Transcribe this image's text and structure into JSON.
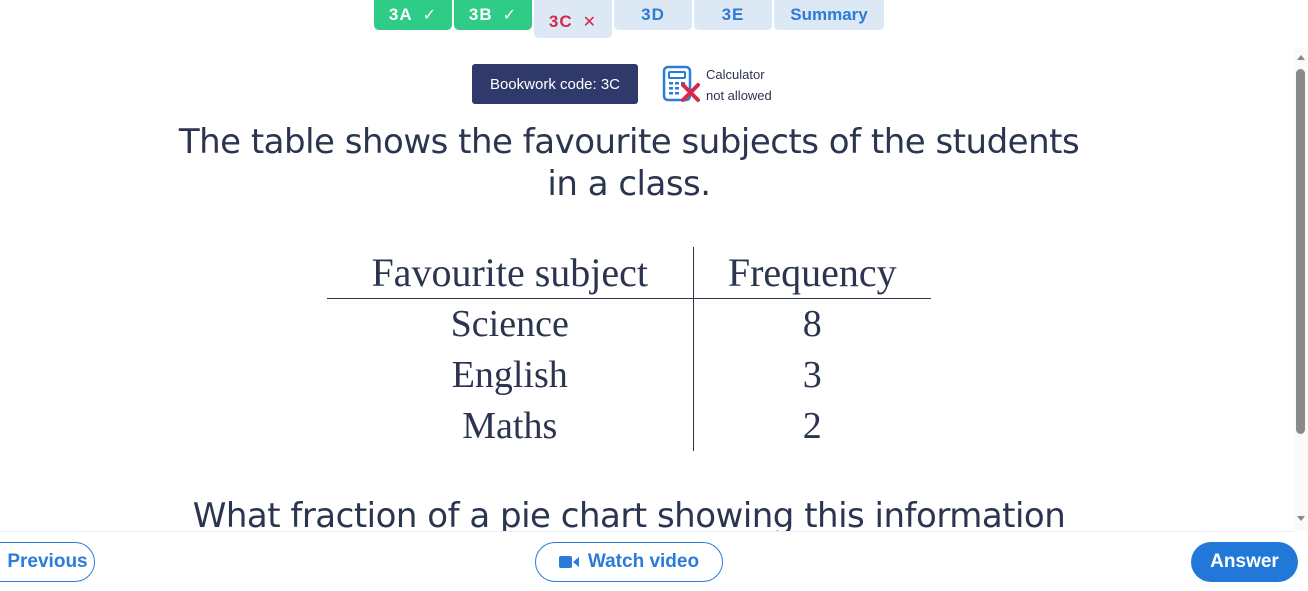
{
  "tabs": [
    {
      "label": "3A",
      "status": "done",
      "mark": "✓"
    },
    {
      "label": "3B",
      "status": "done",
      "mark": "✓"
    },
    {
      "label": "3C",
      "status": "current-wrong",
      "mark": "✕"
    },
    {
      "label": "3D",
      "status": "todo",
      "mark": ""
    },
    {
      "label": "3E",
      "status": "todo",
      "mark": ""
    },
    {
      "label": "Summary",
      "status": "todo",
      "mark": ""
    }
  ],
  "bookwork": {
    "label": "Bookwork code: 3C"
  },
  "calculator": {
    "icon": "calculator-not-allowed-icon",
    "line1": "Calculator",
    "line2": "not allowed"
  },
  "question": {
    "intro_line1": "The table shows the favourite subjects of the students",
    "intro_line2": "in a class.",
    "prompt": "What fraction of a pie chart showing this information"
  },
  "table": {
    "headers": [
      "Favourite subject",
      "Frequency"
    ],
    "rows": [
      {
        "subject": "Science",
        "frequency": "8"
      },
      {
        "subject": "English",
        "frequency": "3"
      },
      {
        "subject": "Maths",
        "frequency": "2"
      }
    ]
  },
  "footer": {
    "previous_label": "Previous",
    "video_label": "Watch video",
    "answer_label": "Answer"
  },
  "colors": {
    "done": "#2ecc86",
    "todo_bg": "#dde8f5",
    "accent": "#2b7bd8",
    "wrong": "#d6294a",
    "bookwork_bg": "#2f3a6b",
    "text": "#2b3550"
  }
}
